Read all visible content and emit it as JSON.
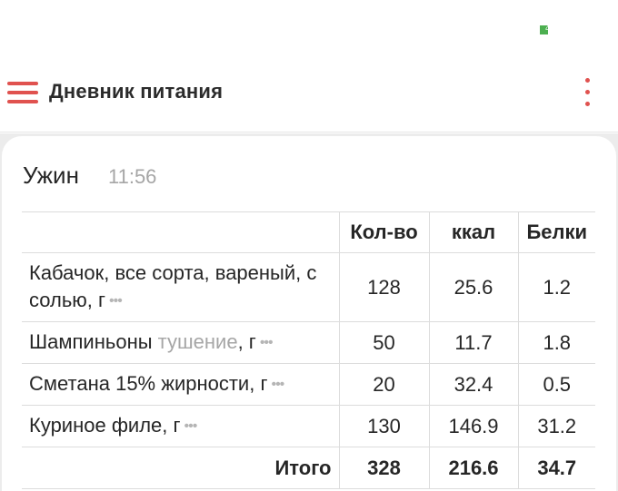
{
  "status_bar": {
    "battery_level": "4",
    "battery_color": "#4caf50"
  },
  "app_bar": {
    "title": "Дневник питания",
    "accent_color": "#e0524f",
    "menu_icon": "hamburger-icon",
    "more_icon": "more-vertical-icon"
  },
  "meal": {
    "name": "Ужин",
    "time": "11:56"
  },
  "table": {
    "columns": [
      "Кол-во",
      "ккал",
      "Белки"
    ],
    "rows": [
      {
        "name": "Кабачок, все сорта, вареный, с солью, г",
        "prep": "",
        "qty": "128",
        "kcal": "25.6",
        "protein": "1.2"
      },
      {
        "name": "Шампиньоны",
        "prep": "тушение",
        "unit": ", г",
        "qty": "50",
        "kcal": "11.7",
        "protein": "1.8"
      },
      {
        "name": "Сметана 15% жирности, г",
        "prep": "",
        "qty": "20",
        "kcal": "32.4",
        "protein": "0.5"
      },
      {
        "name": "Куриное филе, г",
        "prep": "",
        "qty": "130",
        "kcal": "146.9",
        "protein": "31.2"
      }
    ],
    "total": {
      "label": "Итого",
      "qty": "328",
      "kcal": "216.6",
      "protein": "34.7"
    },
    "more_dots": "•••"
  }
}
